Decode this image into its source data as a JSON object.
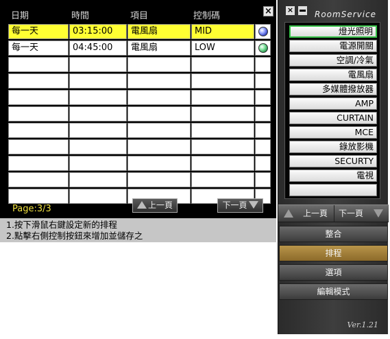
{
  "schedule": {
    "headers": [
      "日期",
      "時間",
      "項目",
      "控制碼"
    ],
    "rows": [
      {
        "date": "每一天",
        "time": "03:15:00",
        "item": "電風扇",
        "code": "MID",
        "selected": true,
        "indicator": "blue-orb"
      },
      {
        "date": "每一天",
        "time": "04:45:00",
        "item": "電風扇",
        "code": "LOW",
        "selected": false,
        "indicator": "green-orb"
      }
    ],
    "empty_rows": 9,
    "page_label": "Page:3/3",
    "prev_label": "上一頁",
    "next_label": "下一頁",
    "help_line1": "1.按下滑鼠右鍵設定新的排程",
    "help_line2": "2.點擊右側控制按鈕來增加並儲存之",
    "close_label": "×"
  },
  "control": {
    "brand": "RoomService",
    "close_label": "×",
    "devices": [
      "燈光照明",
      "電源開關",
      "空調/冷氣",
      "電風扇",
      "多媒體撥放器",
      "AMP",
      "CURTAIN",
      "MCE",
      "錄放影機",
      "SECURTY",
      "電視",
      ""
    ],
    "active_device_index": 0,
    "prev_label": "上一頁",
    "next_label": "下一頁",
    "modes": [
      "整合",
      "排程",
      "選項",
      "編輯模式"
    ],
    "active_mode_index": 1,
    "version": "Ver.1.21"
  },
  "colors": {
    "selected_row": "#ffff33",
    "page_label": "#f0e040",
    "active_mode": "#a07f3a",
    "active_device_border": "#39c24a"
  }
}
